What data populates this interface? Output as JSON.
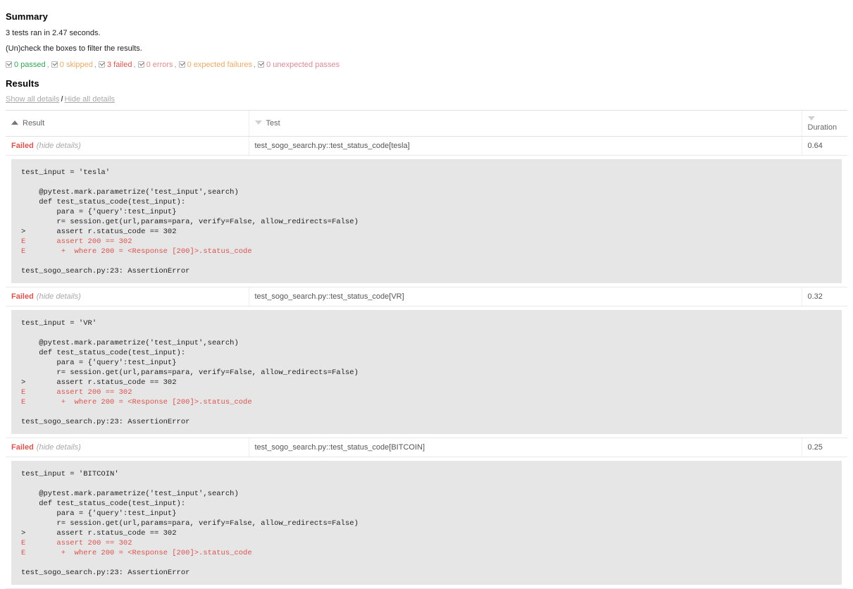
{
  "summary": {
    "heading": "Summary",
    "run_line": "3 tests ran in 2.47 seconds.",
    "filter_hint": "(Un)check the boxes to filter the results.",
    "filters": [
      {
        "label": "0 passed",
        "checked": true,
        "color": "#31a354",
        "name": "passed"
      },
      {
        "label": "0 skipped",
        "checked": true,
        "color": "#eaaa66",
        "name": "skipped"
      },
      {
        "label": "3 failed",
        "checked": true,
        "color": "#d9534f",
        "name": "failed"
      },
      {
        "label": "0 errors",
        "checked": true,
        "color": "#e38b8b",
        "name": "error"
      },
      {
        "label": "0 expected failures",
        "checked": true,
        "color": "#eaaa66",
        "name": "xfailed"
      },
      {
        "label": "0 unexpected passes",
        "checked": true,
        "color": "#d98b94",
        "name": "xpassed"
      }
    ],
    "separator": ","
  },
  "results": {
    "heading": "Results",
    "show_all_label": "Show all details",
    "hide_all_label": "Hide all details",
    "slash": "/",
    "columns": [
      {
        "label": "Result",
        "sort": "asc"
      },
      {
        "label": "Test",
        "sort": "desc"
      },
      {
        "label": "Duration",
        "sort": "desc"
      }
    ],
    "rows": [
      {
        "status": "Failed",
        "toggle_label": "(hide details)",
        "test": "test_sogo_search.py::test_status_code[tesla]",
        "duration": "0.64",
        "log": [
          {
            "text": "test_input = 'tesla'",
            "error": false
          },
          {
            "text": "",
            "error": false
          },
          {
            "text": "    @pytest.mark.parametrize('test_input',search)",
            "error": false
          },
          {
            "text": "    def test_status_code(test_input):",
            "error": false
          },
          {
            "text": "        para = {'query':test_input}",
            "error": false
          },
          {
            "text": "        r= session.get(url,params=para, verify=False, allow_redirects=False)",
            "error": false
          },
          {
            "text": ">       assert r.status_code == 302",
            "error": false
          },
          {
            "text": "E       assert 200 == 302",
            "error": true
          },
          {
            "text": "E        +  where 200 = <Response [200]>.status_code",
            "error": true
          },
          {
            "text": "",
            "error": false
          },
          {
            "text": "test_sogo_search.py:23: AssertionError",
            "error": false
          }
        ]
      },
      {
        "status": "Failed",
        "toggle_label": "(hide details)",
        "test": "test_sogo_search.py::test_status_code[VR]",
        "duration": "0.32",
        "log": [
          {
            "text": "test_input = 'VR'",
            "error": false
          },
          {
            "text": "",
            "error": false
          },
          {
            "text": "    @pytest.mark.parametrize('test_input',search)",
            "error": false
          },
          {
            "text": "    def test_status_code(test_input):",
            "error": false
          },
          {
            "text": "        para = {'query':test_input}",
            "error": false
          },
          {
            "text": "        r= session.get(url,params=para, verify=False, allow_redirects=False)",
            "error": false
          },
          {
            "text": ">       assert r.status_code == 302",
            "error": false
          },
          {
            "text": "E       assert 200 == 302",
            "error": true
          },
          {
            "text": "E        +  where 200 = <Response [200]>.status_code",
            "error": true
          },
          {
            "text": "",
            "error": false
          },
          {
            "text": "test_sogo_search.py:23: AssertionError",
            "error": false
          }
        ]
      },
      {
        "status": "Failed",
        "toggle_label": "(hide details)",
        "test": "test_sogo_search.py::test_status_code[BITCOIN]",
        "duration": "0.25",
        "log": [
          {
            "text": "test_input = 'BITCOIN'",
            "error": false
          },
          {
            "text": "",
            "error": false
          },
          {
            "text": "    @pytest.mark.parametrize('test_input',search)",
            "error": false
          },
          {
            "text": "    def test_status_code(test_input):",
            "error": false
          },
          {
            "text": "        para = {'query':test_input}",
            "error": false
          },
          {
            "text": "        r= session.get(url,params=para, verify=False, allow_redirects=False)",
            "error": false
          },
          {
            "text": ">       assert r.status_code == 302",
            "error": false
          },
          {
            "text": "E       assert 200 == 302",
            "error": true
          },
          {
            "text": "E        +  where 200 = <Response [200]>.status_code",
            "error": true
          },
          {
            "text": "",
            "error": false
          },
          {
            "text": "test_sogo_search.py:23: AssertionError",
            "error": false
          }
        ]
      }
    ]
  }
}
